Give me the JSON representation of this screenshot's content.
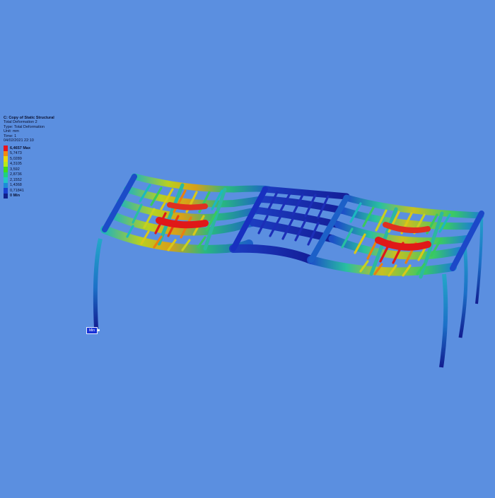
{
  "legend": {
    "title": "C: Copy of Static Structural",
    "lines": [
      "Total Deformation 2",
      "Type: Total Deformation",
      "Unit: mm",
      "Time: 1",
      "04/02/2021 22:10"
    ],
    "scale": [
      {
        "label": "6,4657 Max",
        "color": "#e8141c"
      },
      {
        "label": "5,7473",
        "color": "#f28a10"
      },
      {
        "label": "5,0289",
        "color": "#e8d80c"
      },
      {
        "label": "4,3105",
        "color": "#b8e818"
      },
      {
        "label": "3,592",
        "color": "#3edc1c"
      },
      {
        "label": "2,8736",
        "color": "#1ed080"
      },
      {
        "label": "2,1552",
        "color": "#22c4c8"
      },
      {
        "label": "1,4368",
        "color": "#1c8cd8"
      },
      {
        "label": "0,71841",
        "color": "#1a40d0"
      },
      {
        "label": "0 Min",
        "color": "#10208c"
      }
    ]
  },
  "probe": {
    "label": "Min"
  },
  "colors": {
    "background": "#5b8fe0",
    "min_blue": "#141fa0",
    "cyan": "#24a8c8",
    "green": "#28c860",
    "yellow": "#d8c818",
    "orange": "#e88010",
    "red": "#e01818"
  }
}
